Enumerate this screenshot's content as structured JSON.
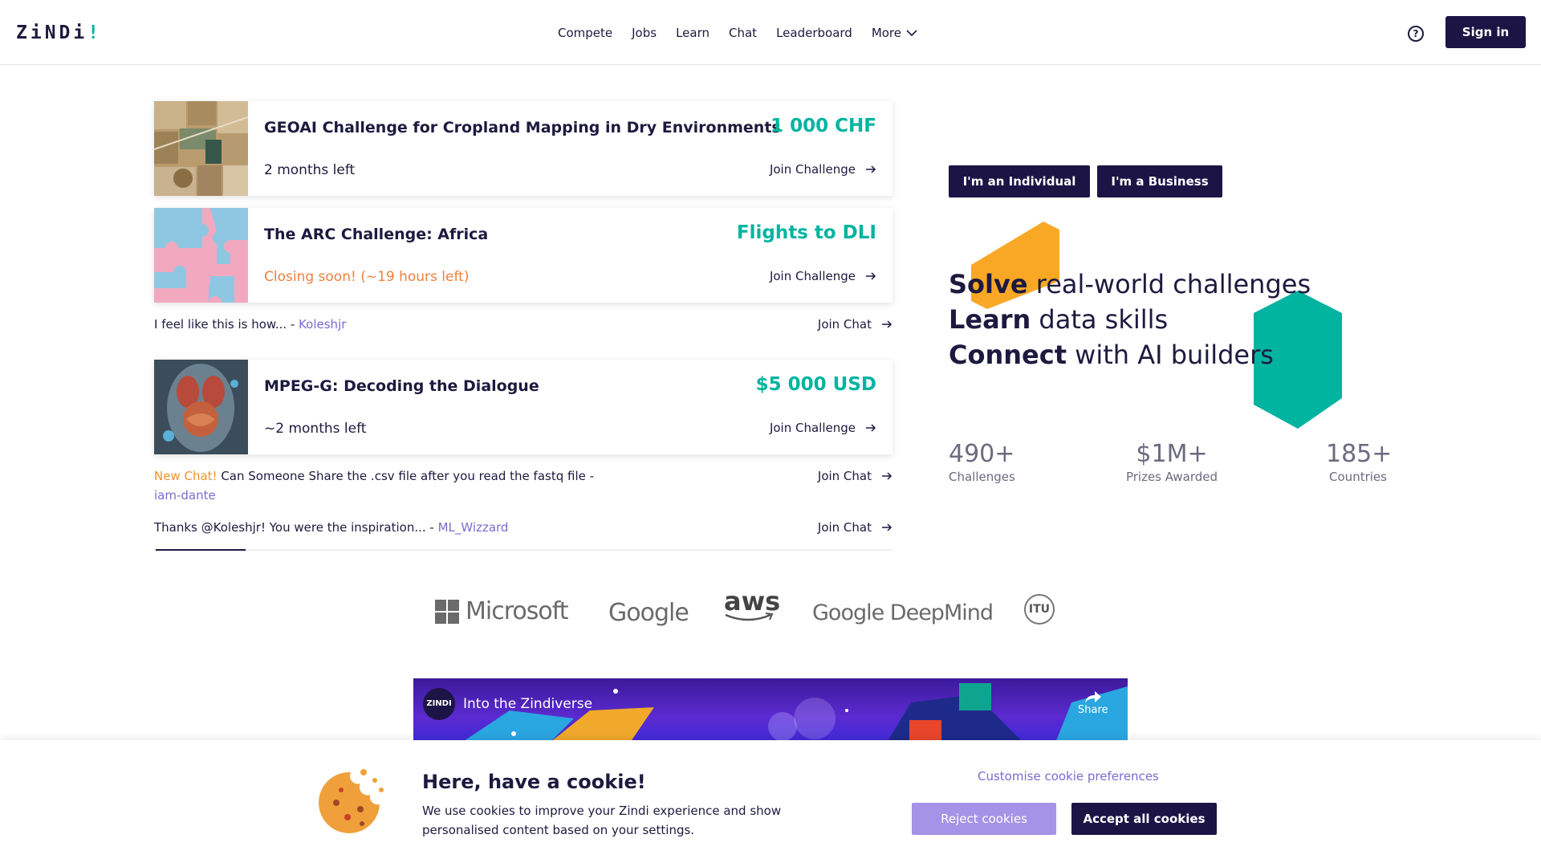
{
  "header": {
    "logo": "ZiNDi",
    "logo_bang": "!",
    "nav": [
      "Compete",
      "Jobs",
      "Learn",
      "Chat",
      "Leaderboard"
    ],
    "more_label": "More",
    "help_glyph": "?",
    "signin_label": "Sign in"
  },
  "challenges": [
    {
      "title": "GEOAI Challenge for Cropland Mapping in Dry Environments",
      "prize": "1 000 CHF",
      "status": "2 months left",
      "join_label": "Join Challenge"
    },
    {
      "title": "The ARC Challenge: Africa",
      "prize": "Flights to DLI",
      "status": "Closing soon! (~19 hours left)",
      "join_label": "Join Challenge"
    },
    {
      "title": "MPEG-G: Decoding the Dialogue",
      "prize": "$5 000 USD",
      "status": "~2 months left",
      "join_label": "Join Challenge"
    }
  ],
  "chats": [
    {
      "new_label": "",
      "text": "I feel like this is how... - ",
      "user": "Koleshjr",
      "join_label": "Join Chat"
    },
    {
      "new_label": "New Chat!",
      "text": " Can Someone Share the .csv file after you read the fastq file - ",
      "user": "iam-dante",
      "join_label": "Join Chat"
    },
    {
      "new_label": "",
      "text": "Thanks @Koleshjr! You were the inspiration... - ",
      "user": "ML_Wizzard",
      "join_label": "Join Chat"
    }
  ],
  "hero": {
    "individual_button": "I'm an Individual",
    "business_button": "I'm a Business",
    "lines": [
      {
        "bold": "Solve",
        "rest": " real-world challenges"
      },
      {
        "bold": "Learn",
        "rest": " data skills"
      },
      {
        "bold": "Connect",
        "rest": " with AI builders"
      }
    ],
    "stats": [
      {
        "value": "490+",
        "label": "Challenges"
      },
      {
        "value": "$1M+",
        "label": "Prizes Awarded"
      },
      {
        "value": "185+",
        "label": "Countries"
      }
    ],
    "colors": {
      "orange": "#f9a826",
      "teal": "#00b4a0"
    }
  },
  "partners": {
    "microsoft": "Microsoft",
    "google": "Google",
    "aws": "aws",
    "deepmind": "Google DeepMind",
    "itu": "ITU"
  },
  "video": {
    "channel_logo": "ZINDI",
    "title": "Into the Zindiverse",
    "share_label": "Share"
  },
  "cookie": {
    "title": "Here, have a cookie!",
    "text": "We use cookies to improve your Zindi experience and show personalised content based on your settings.",
    "customise_label": "Customise cookie preferences",
    "reject_label": "Reject cookies",
    "accept_label": "Accept all cookies"
  }
}
